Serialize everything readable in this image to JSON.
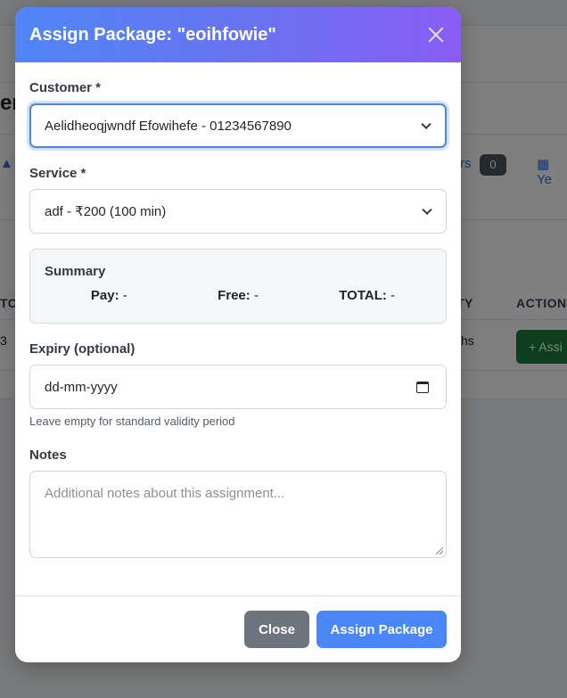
{
  "background": {
    "title_fragment": "er",
    "tab_fragment": "rs",
    "badge": "0",
    "tab_year_fragment": "Ye",
    "th_tot": "TOT",
    "th_ty": "TY",
    "th_actions": "ACTIONS",
    "td_num": "3",
    "td_hs": "hs",
    "assign_fragment": "+ Assi"
  },
  "modal": {
    "title": "Assign Package: \"eoihfowie\"",
    "customer": {
      "label": "Customer *",
      "value": "Aelidheoqjwndf Efowihefe - 01234567890"
    },
    "service": {
      "label": "Service *",
      "value": "adf - ₹200 (100 min)"
    },
    "summary": {
      "title": "Summary",
      "pay_label": "Pay:",
      "pay_value": "-",
      "free_label": "Free:",
      "free_value": "-",
      "total_label": "TOTAL:",
      "total_value": "-"
    },
    "expiry": {
      "label": "Expiry (optional)",
      "placeholder": "dd-mm-yyyy",
      "help": "Leave empty for standard validity period"
    },
    "notes": {
      "label": "Notes",
      "placeholder": "Additional notes about this assignment..."
    },
    "footer": {
      "close_label": "Close",
      "assign_label": "Assign Package"
    }
  }
}
